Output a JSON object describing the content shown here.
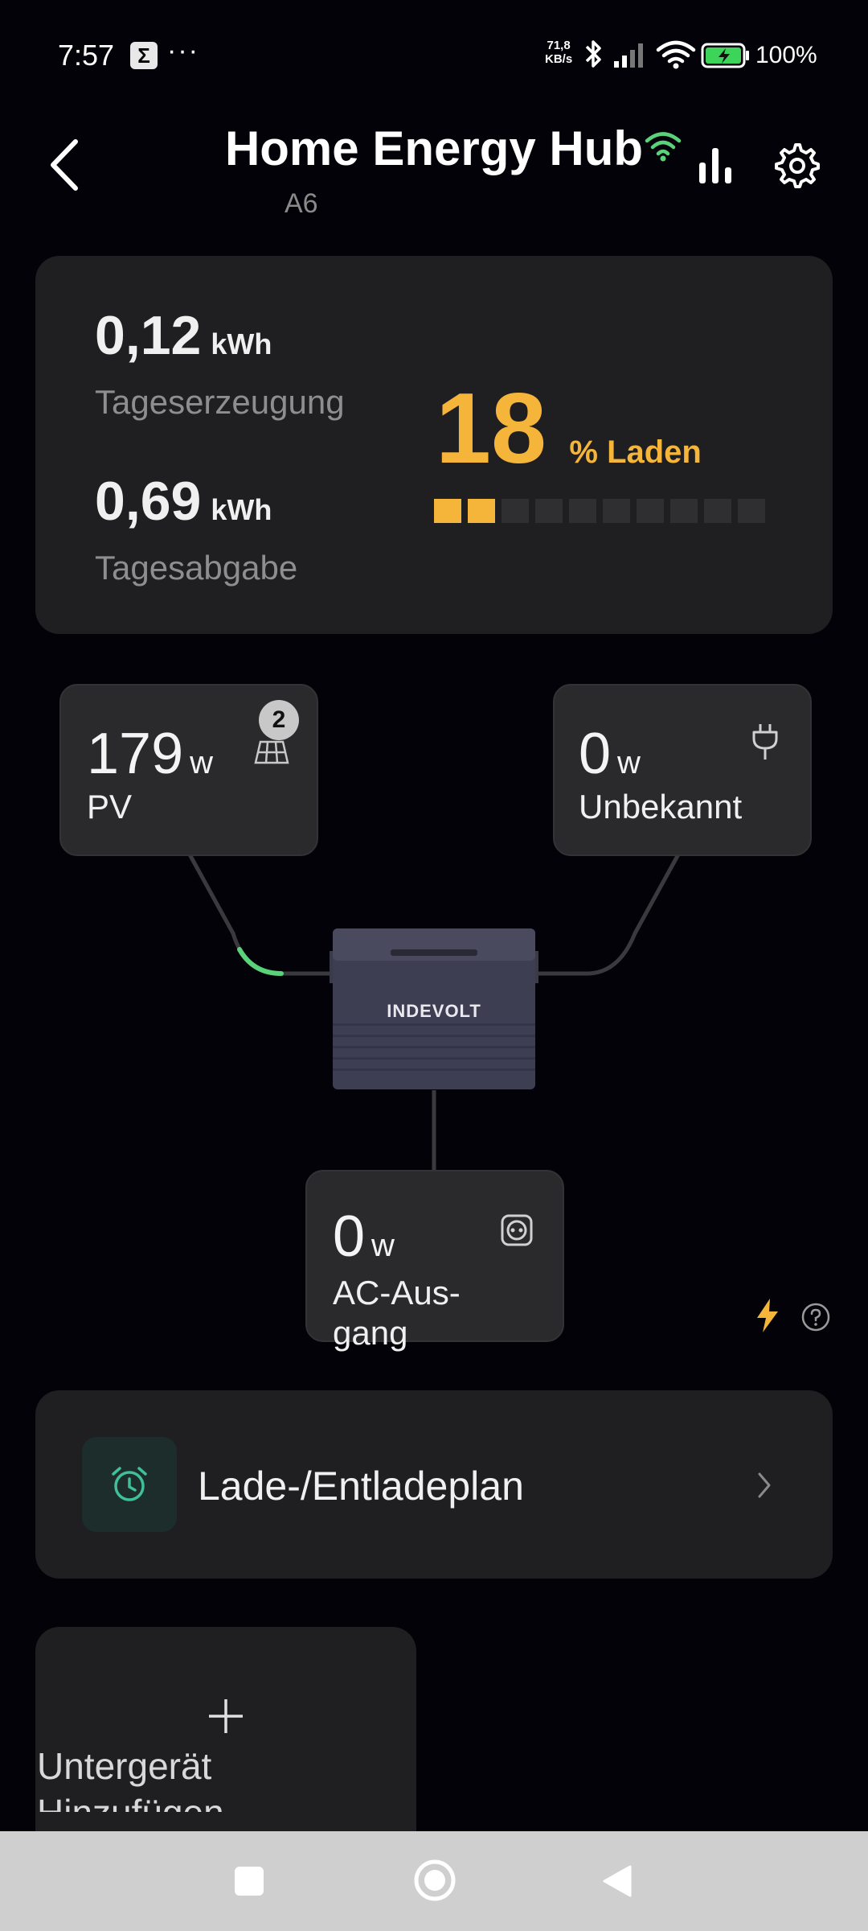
{
  "status_bar": {
    "time": "7:57",
    "sigma": "Σ",
    "dots": "···",
    "net_speed_value": "71,8",
    "net_speed_unit": "KB/s",
    "battery_pct": "100%"
  },
  "header": {
    "title": "Home Energy Hub",
    "serial": "A6"
  },
  "stats": {
    "generation_value": "0,12",
    "generation_unit": "kWh",
    "generation_label": "Tageserzeugung",
    "output_value": "0,69",
    "output_unit": "kWh",
    "output_label": "Tagesabgabe",
    "soc_value": "18",
    "soc_label": "% Laden",
    "soc_percent": 18
  },
  "flow": {
    "pv": {
      "value": "179",
      "unit": "w",
      "label": "PV",
      "badge": "2"
    },
    "grid": {
      "value": "0",
      "unit": "w",
      "label": "Unbekannt"
    },
    "ac": {
      "value": "0",
      "unit": "w",
      "label": "AC-Aus-gang"
    },
    "device_brand": "INDEVOLT"
  },
  "plan": {
    "label": "Lade-/Entladeplan"
  },
  "add_device": {
    "label": "Untergerät Hinzufügen"
  },
  "colors": {
    "accent": "#f5b53b",
    "green": "#5ad27a",
    "card": "#1f1f21",
    "background": "#020208"
  }
}
